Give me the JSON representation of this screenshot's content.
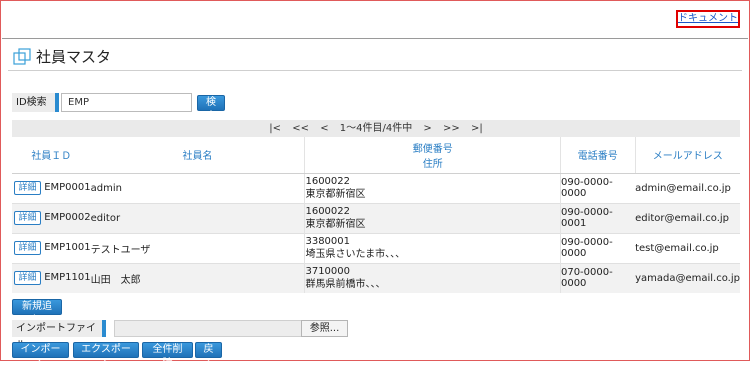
{
  "header": {
    "doc_link": "ドキュメント"
  },
  "page": {
    "title": "社員マスタ"
  },
  "search": {
    "label": "ID検索",
    "value": "EMP",
    "button": "検索"
  },
  "pager": {
    "first": "|<",
    "prev_block": "<<",
    "prev": "<",
    "info": "1～4件目/4件中",
    "next": ">",
    "next_block": ">>",
    "last": ">|"
  },
  "table": {
    "columns": {
      "id": "社員ＩＤ",
      "name": "社員名",
      "postal": "郵便番号",
      "address": "住所",
      "phone": "電話番号",
      "email": "メールアドレス"
    },
    "detail_label": "詳細",
    "rows": [
      {
        "id": "EMP0001",
        "name": "admin",
        "postal": "1600022",
        "address": "東京都新宿区",
        "phone": "090-0000-0000",
        "email": "admin@email.co.jp"
      },
      {
        "id": "EMP0002",
        "name": "editor",
        "postal": "1600022",
        "address": "東京都新宿区",
        "phone": "090-0000-0001",
        "email": "editor@email.co.jp"
      },
      {
        "id": "EMP1001",
        "name": "テストユーザ",
        "postal": "3380001",
        "address": "埼玉県さいたま市、、、",
        "phone": "090-0000-0000",
        "email": "test@email.co.jp"
      },
      {
        "id": "EMP1101",
        "name": "山田　太郎",
        "postal": "3710000",
        "address": "群馬県前橋市、、、",
        "phone": "070-0000-0000",
        "email": "yamada@email.co.jp"
      }
    ]
  },
  "actions": {
    "add": "新規追加",
    "import_label": "インポートファイル",
    "browse": "参照...",
    "import": "インポート",
    "export": "エクスポート",
    "delete_all": "全件削除",
    "back": "戻る"
  },
  "colors": {
    "accent": "#2a8bd0",
    "link": "#1a56c8",
    "highlight_border": "#e00000"
  },
  "icons": {
    "title": "page-icon"
  }
}
